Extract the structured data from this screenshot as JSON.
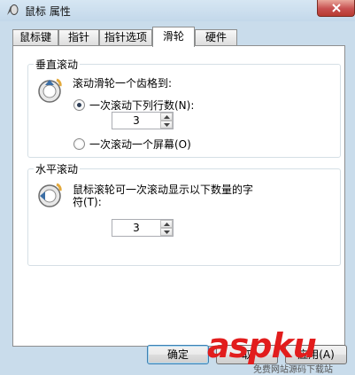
{
  "window": {
    "title": "鼠标 属性"
  },
  "tabs": [
    {
      "label": "鼠标键",
      "active": false
    },
    {
      "label": "指针",
      "active": false
    },
    {
      "label": "指针选项",
      "active": false
    },
    {
      "label": "滑轮",
      "active": true
    },
    {
      "label": "硬件",
      "active": false
    }
  ],
  "vertical_scroll": {
    "title": "垂直滚动",
    "prompt": "滚动滑轮一个齿格到:",
    "option_lines": "一次滚动下列行数(N):",
    "lines_value": "3",
    "option_screen": "一次滚动一个屏幕(O)",
    "selected": "lines"
  },
  "horizontal_scroll": {
    "title": "水平滚动",
    "prompt_line1": "鼠标滚轮可一次滚动显示以下数量的字",
    "prompt_line2": "符(T):",
    "chars_value": "3"
  },
  "buttons": {
    "ok": "确定",
    "cancel": "取",
    "apply": "应用(A)"
  },
  "watermark": {
    "logo": "aspku",
    "sub": "免费网站源码下载站"
  },
  "colors": {
    "close": "#c75050",
    "accent": "#3c7fb1",
    "watermark": "#e21d1d"
  }
}
